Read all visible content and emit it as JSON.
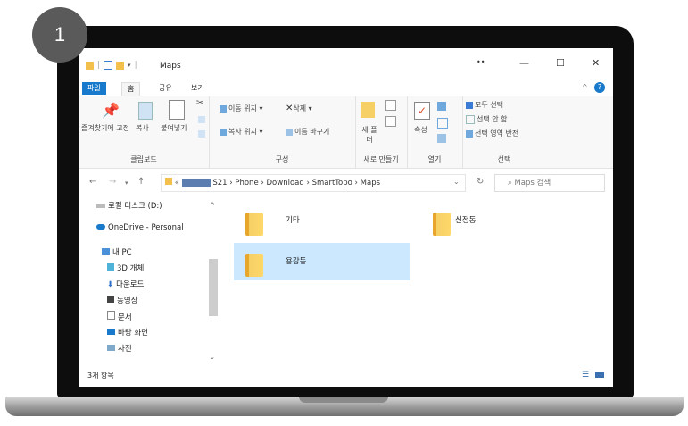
{
  "badge": "1",
  "window": {
    "title": "Maps",
    "controls": {
      "minimize": "—",
      "maximize": "☐",
      "close": "✕"
    },
    "dots": "••"
  },
  "tabs": [
    "파일",
    "홈",
    "공유",
    "보기"
  ],
  "ribbon": {
    "clipboard": {
      "pin": "즐겨찾기에 고정",
      "copy": "복사",
      "paste": "붙여넣기",
      "label": "클립보드"
    },
    "organize": {
      "move": "이동 위치 ▾",
      "delete": "삭제 ▾",
      "copy_to": "복사 위치 ▾",
      "rename": "이름 바꾸기",
      "label": "구성"
    },
    "new": {
      "folder": "새 폴더",
      "label": "새로 만들기"
    },
    "open": {
      "properties": "속성",
      "label": "열기"
    },
    "select": {
      "all": "모두 선택",
      "none": "선택 안 함",
      "invert": "선택 영역 반전",
      "label": "선택"
    }
  },
  "address": {
    "path": [
      "S21",
      "Phone",
      "Download",
      "SmartTopo",
      "Maps"
    ],
    "search_placeholder": "Maps 검색"
  },
  "nav_pane": [
    {
      "label": "로컬 디스크 (D:)",
      "icon": "drive-icon"
    },
    {
      "label": "OneDrive - Personal",
      "icon": "cloud-icon"
    },
    {
      "label": "내 PC",
      "icon": "pc-icon"
    },
    {
      "label": "3D 개체",
      "icon": "cube-icon"
    },
    {
      "label": "다운로드",
      "icon": "download-icon"
    },
    {
      "label": "동영상",
      "icon": "video-icon"
    },
    {
      "label": "문서",
      "icon": "document-icon"
    },
    {
      "label": "바탕 화면",
      "icon": "desktop-icon"
    },
    {
      "label": "사진",
      "icon": "picture-icon"
    }
  ],
  "folders": [
    {
      "name": "기타",
      "selected": false
    },
    {
      "name": "신정동",
      "selected": false
    },
    {
      "name": "용강동",
      "selected": true
    }
  ],
  "status": {
    "count": "3개 항목"
  },
  "colors": {
    "accent": "#1979ca",
    "selection": "#cce8ff",
    "folder": "#ffd86b"
  }
}
